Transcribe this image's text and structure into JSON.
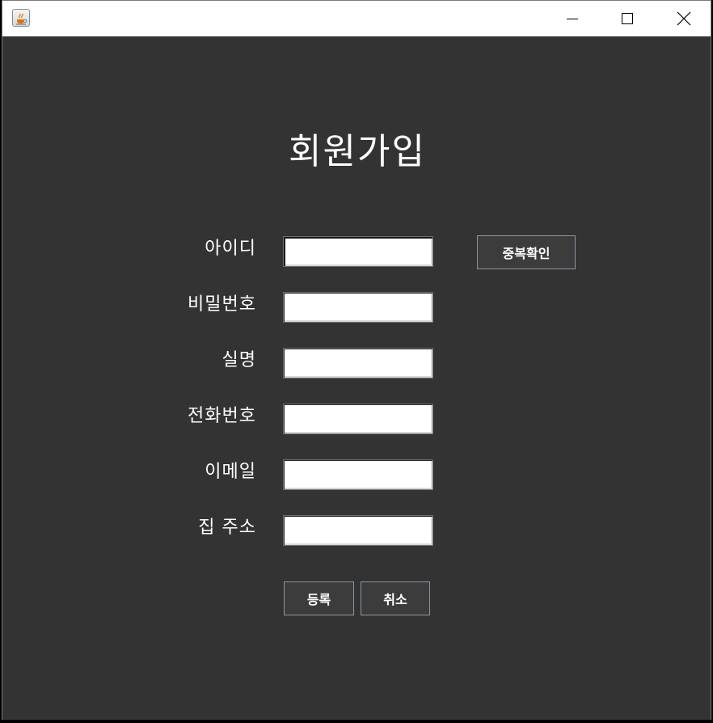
{
  "window": {
    "icon": "java-coffee-icon",
    "controls": {
      "minimize_icon": "minimize-icon",
      "maximize_icon": "maximize-icon",
      "close_icon": "close-icon"
    }
  },
  "form": {
    "title": "회원가입",
    "fields": [
      {
        "label": "아이디",
        "value": ""
      },
      {
        "label": "비밀번호",
        "value": ""
      },
      {
        "label": "실명",
        "value": ""
      },
      {
        "label": "전화번호",
        "value": ""
      },
      {
        "label": "이메일",
        "value": ""
      },
      {
        "label": "집 주소",
        "value": ""
      }
    ],
    "duplicate_check_label": "중복확인",
    "register_label": "등록",
    "cancel_label": "취소"
  },
  "colors": {
    "background": "#333333",
    "titlebar": "#ffffff",
    "button_bg": "#3c3c3c",
    "button_border": "#8a95a3",
    "text": "#ffffff"
  }
}
